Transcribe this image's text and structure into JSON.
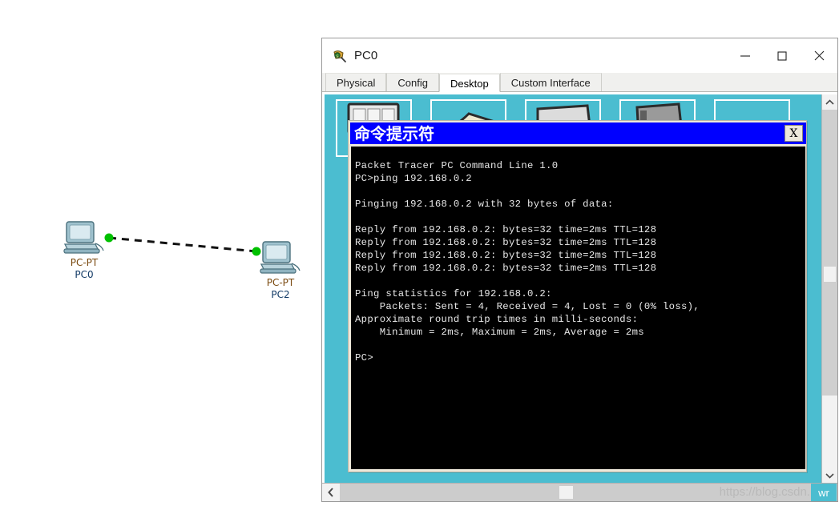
{
  "topology": {
    "devices": [
      {
        "id": "pc0",
        "model": "PC-PT",
        "name": "PC0"
      },
      {
        "id": "pc2",
        "model": "PC-PT",
        "name": "PC2"
      }
    ],
    "link": {
      "style": "dashed",
      "endpoint_color": "#00c000",
      "line_color": "#111111"
    }
  },
  "window": {
    "title": "PC0",
    "icon": "packet-tracer-icon",
    "minimize_label": "—",
    "maximize_label": "□",
    "close_label": "✕"
  },
  "tabs": [
    {
      "label": "Physical",
      "active": false
    },
    {
      "label": "Config",
      "active": false
    },
    {
      "label": "Desktop",
      "active": true
    },
    {
      "label": "Custom Interface",
      "active": false
    }
  ],
  "desktop": {
    "background_color": "#4bbdd0",
    "icon_tiles": 5
  },
  "terminal": {
    "title": "命令提示符",
    "titlebar_color": "#0000ff",
    "close_button_label": "X",
    "background_color": "#000000",
    "text_color": "#e8e8e8",
    "content": "Packet Tracer PC Command Line 1.0\nPC>ping 192.168.0.2\n\nPinging 192.168.0.2 with 32 bytes of data:\n\nReply from 192.168.0.2: bytes=32 time=2ms TTL=128\nReply from 192.168.0.2: bytes=32 time=2ms TTL=128\nReply from 192.168.0.2: bytes=32 time=2ms TTL=128\nReply from 192.168.0.2: bytes=32 time=2ms TTL=128\n\nPing statistics for 192.168.0.2:\n    Packets: Sent = 4, Received = 4, Lost = 0 (0% loss),\nApproximate round trip times in milli-seconds:\n    Minimum = 2ms, Maximum = 2ms, Average = 2ms\n\nPC>"
  },
  "scrollbars": {
    "vertical_up_label": "⌃",
    "vertical_down_label": "⌄",
    "horizontal_left_label": "‹"
  },
  "watermark": {
    "text": "https://blog.csdn.net/",
    "badge": "wr"
  }
}
